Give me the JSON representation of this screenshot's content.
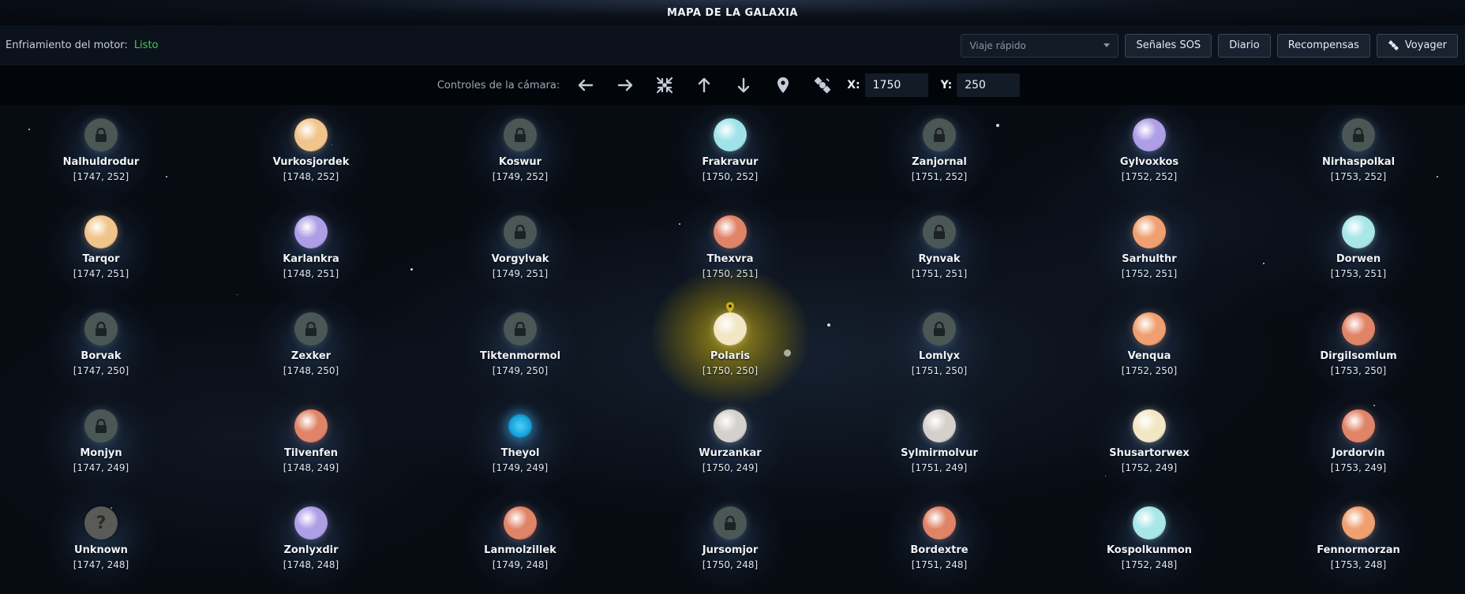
{
  "title": "MAPA DE LA GALAXIA",
  "engine": {
    "label": "Enfriamiento del motor:",
    "status": "Listo",
    "status_color": "#3fcf4f"
  },
  "fast_travel": {
    "placeholder": "Viaje rápido"
  },
  "buttons": {
    "sos": "Señales SOS",
    "diary": "Diario",
    "rewards": "Recompensas",
    "voyager": "Voyager"
  },
  "camera": {
    "label": "Controles de la cámara:",
    "x_label": "X:",
    "x_value": "1750",
    "y_label": "Y:",
    "y_value": "250",
    "icons": [
      "arrow-left-icon",
      "arrow-right-icon",
      "center-collapse-icon",
      "arrow-up-icon",
      "arrow-down-icon",
      "location-pin-icon",
      "satellite-icon"
    ]
  },
  "colors": {
    "accent_current": "#c8af14",
    "background": "#05080d"
  },
  "grid": {
    "rows": [
      [
        {
          "name": "Nalhuldrodur",
          "coords": "[1747, 252]",
          "type": "locked"
        },
        {
          "name": "Vurkosjordek",
          "coords": "[1748, 252]",
          "type": "planet",
          "color": "#f0c48a"
        },
        {
          "name": "Koswur",
          "coords": "[1749, 252]",
          "type": "locked"
        },
        {
          "name": "Frakravur",
          "coords": "[1750, 252]",
          "type": "planet",
          "color": "#9fe3e8"
        },
        {
          "name": "Zanjornal",
          "coords": "[1751, 252]",
          "type": "locked"
        },
        {
          "name": "Gylvoxkos",
          "coords": "[1752, 252]",
          "type": "planet",
          "color": "#ad9ee6"
        },
        {
          "name": "Nirhaspolkal",
          "coords": "[1753, 252]",
          "type": "locked"
        }
      ],
      [
        {
          "name": "Tarqor",
          "coords": "[1747, 251]",
          "type": "planet",
          "color": "#f0c48a"
        },
        {
          "name": "Karlankra",
          "coords": "[1748, 251]",
          "type": "planet",
          "color": "#ad9ee6"
        },
        {
          "name": "Vorgylvak",
          "coords": "[1749, 251]",
          "type": "locked"
        },
        {
          "name": "Thexvra",
          "coords": "[1750, 251]",
          "type": "planet",
          "color": "#e08468"
        },
        {
          "name": "Rynvak",
          "coords": "[1751, 251]",
          "type": "locked"
        },
        {
          "name": "Sarhulthr",
          "coords": "[1752, 251]",
          "type": "planet",
          "color": "#f0a070"
        },
        {
          "name": "Dorwen",
          "coords": "[1753, 251]",
          "type": "planet",
          "color": "#a8e6e8"
        }
      ],
      [
        {
          "name": "Borvak",
          "coords": "[1747, 250]",
          "type": "locked"
        },
        {
          "name": "Zexker",
          "coords": "[1748, 250]",
          "type": "locked"
        },
        {
          "name": "Tiktenmormol",
          "coords": "[1749, 250]",
          "type": "locked"
        },
        {
          "name": "Polaris",
          "coords": "[1750, 250]",
          "type": "current",
          "color": "#f3e6c4"
        },
        {
          "name": "Lomlyx",
          "coords": "[1751, 250]",
          "type": "locked"
        },
        {
          "name": "Venqua",
          "coords": "[1752, 250]",
          "type": "planet",
          "color": "#f0a070"
        },
        {
          "name": "Dirgilsomlum",
          "coords": "[1753, 250]",
          "type": "planet",
          "color": "#e08468"
        }
      ],
      [
        {
          "name": "Monjyn",
          "coords": "[1747, 249]",
          "type": "locked"
        },
        {
          "name": "Tilvenfen",
          "coords": "[1748, 249]",
          "type": "planet",
          "color": "#e08468"
        },
        {
          "name": "Theyol",
          "coords": "[1749, 249]",
          "type": "black-hole"
        },
        {
          "name": "Wurzankar",
          "coords": "[1750, 249]",
          "type": "planet",
          "color": "#d4d0cc"
        },
        {
          "name": "Sylmirmolvur",
          "coords": "[1751, 249]",
          "type": "planet",
          "color": "#d4d0cc"
        },
        {
          "name": "Shusartorwex",
          "coords": "[1752, 249]",
          "type": "planet",
          "color": "#f3e6c4"
        },
        {
          "name": "Jordorvin",
          "coords": "[1753, 249]",
          "type": "planet",
          "color": "#e08468"
        }
      ],
      [
        {
          "name": "Unknown",
          "coords": "[1747, 248]",
          "type": "unknown"
        },
        {
          "name": "Zonlyxdir",
          "coords": "[1748, 248]",
          "type": "planet",
          "color": "#ad9ee6"
        },
        {
          "name": "Lanmolzillek",
          "coords": "[1749, 248]",
          "type": "planet",
          "color": "#e08468"
        },
        {
          "name": "Jursomjor",
          "coords": "[1750, 248]",
          "type": "locked"
        },
        {
          "name": "Bordextre",
          "coords": "[1751, 248]",
          "type": "planet",
          "color": "#e08468"
        },
        {
          "name": "Kospolkunmon",
          "coords": "[1752, 248]",
          "type": "planet",
          "color": "#a8e6e8"
        },
        {
          "name": "Fennormorzan",
          "coords": "[1753, 248]",
          "type": "planet",
          "color": "#f0a070"
        }
      ]
    ]
  }
}
